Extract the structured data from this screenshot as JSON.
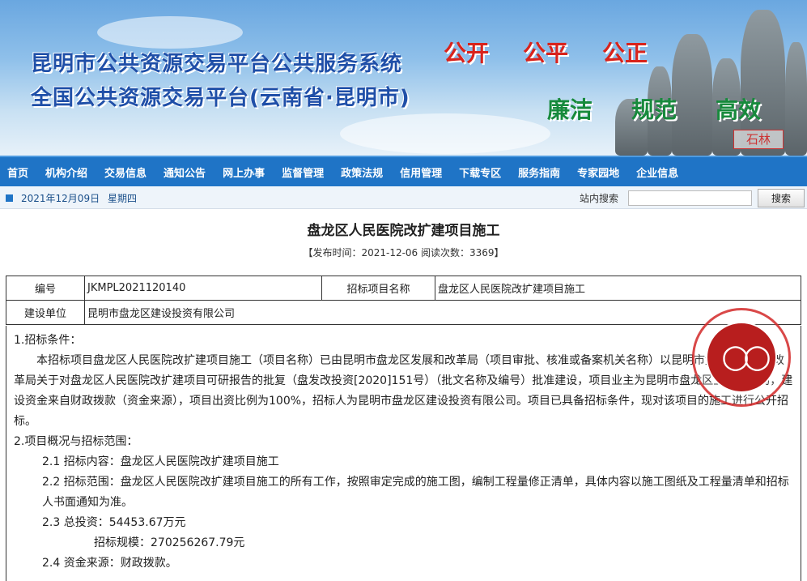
{
  "banner": {
    "title_line1": "昆明市公共资源交易平台公共服务系统",
    "title_line2": "全国公共资源交易平台(云南省·昆明市)",
    "slogans_top": [
      "公开",
      "公平",
      "公正"
    ],
    "slogans_bottom": [
      "廉洁",
      "规范",
      "高效"
    ],
    "tag": "石林"
  },
  "nav": {
    "items": [
      "首页",
      "机构介绍",
      "交易信息",
      "通知公告",
      "网上办事",
      "监督管理",
      "政策法规",
      "信用管理",
      "下载专区",
      "服务指南",
      "专家园地",
      "企业信息"
    ]
  },
  "datebar": {
    "date": "2021年12月09日",
    "weekday": "星期四",
    "search_label": "站内搜索",
    "search_value": "",
    "search_button": "搜索"
  },
  "article": {
    "title": "盘龙区人民医院改扩建项目施工",
    "meta": "【发布时间：2021-12-06  阅读次数：3369】"
  },
  "info_table": {
    "row1": {
      "label1": "编号",
      "value1": "JKMPL2021120140",
      "label2": "招标项目名称",
      "value2": "盘龙区人民医院改扩建项目施工"
    },
    "row2": {
      "label1": "建设单位",
      "value1": "昆明市盘龙区建设投资有限公司"
    }
  },
  "body": {
    "s1_heading": "1.招标条件：",
    "s1_para": "本招标项目盘龙区人民医院改扩建项目施工（项目名称）已由昆明市盘龙区发展和改革局（项目审批、核准或备案机关名称）以昆明市盘龙区发展和改革局关于对盘龙区人民医院改扩建项目可研报告的批复（盘发改投资[2020]151号）（批文名称及编号）批准建设，项目业主为昆明市盘龙区卫生健康局，建设资金来自财政拨款（资金来源），项目出资比例为100%，招标人为昆明市盘龙区建设投资有限公司。项目已具备招标条件，现对该项目的施工进行公开招标。",
    "s2_heading": "2.项目概况与招标范围：",
    "s2_1": "2.1 招标内容：盘龙区人民医院改扩建项目施工",
    "s2_2": "2.2 招标范围：盘龙区人民医院改扩建项目施工的所有工作，按照审定完成的施工图，编制工程量修正清单，具体内容以施工图纸及工程量清单和招标人书面通知为准。",
    "s2_3": "2.3 总投资：54453.67万元",
    "s2_3b": "招标规模：270256267.79元",
    "s2_4": "2.4 资金来源：财政拨款。"
  },
  "colors": {
    "nav_bg": "#1f74c6",
    "title_blue": "#1f4fa8",
    "slogan_red": "#d8231c",
    "slogan_green": "#178a3c",
    "seal_red": "#b81e1e"
  }
}
